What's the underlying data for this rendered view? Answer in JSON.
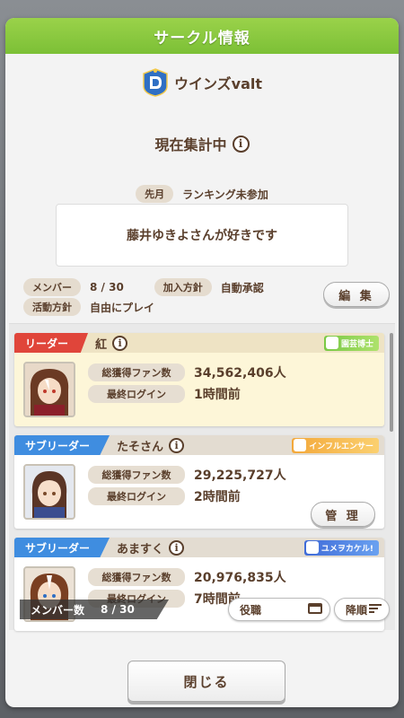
{
  "header": {
    "title": "サークル情報"
  },
  "circle": {
    "name": "ウインズvalt",
    "status": "現在集計中"
  },
  "last_month": {
    "label": "先月",
    "value": "ランキング未参加"
  },
  "slogan": "藤井ゆきよさんが好きです",
  "meta": {
    "members_label": "メンバー",
    "members_value": "8 / 30",
    "join_label": "加入方針",
    "join_value": "自動承認",
    "policy_label": "活動方針",
    "policy_value": "自由にプレイ"
  },
  "edit_button": "編 集",
  "stat_labels": {
    "fans": "総獲得ファン数",
    "login": "最終ログイン"
  },
  "members": [
    {
      "role": "リーダー",
      "name": "紅",
      "badge": "園芸博士",
      "fans": "34,562,406人",
      "login": "1時間前"
    },
    {
      "role": "サブリーダー",
      "name": "たそさん",
      "badge": "インフルエンサー",
      "fans": "29,225,727人",
      "login": "2時間前",
      "manage": "管 理"
    },
    {
      "role": "サブリーダー",
      "name": "あますく",
      "badge": "ユメヲカケル!",
      "fans": "20,976,835人",
      "login": "7時間前"
    }
  ],
  "footer": {
    "count_label": "メンバー数",
    "count_value": "8 / 30",
    "role_sort": "役職",
    "order_sort": "降順"
  },
  "close_button": "閉じる",
  "colors": {
    "header_green": "#8cc63f",
    "leader_red": "#e0453a",
    "sub_blue": "#3f8de0",
    "text_brown": "#5a3f2c"
  },
  "icons": [
    "circle-emblem-icon",
    "info-icon",
    "title-badge-icon",
    "sort-list-icon"
  ]
}
